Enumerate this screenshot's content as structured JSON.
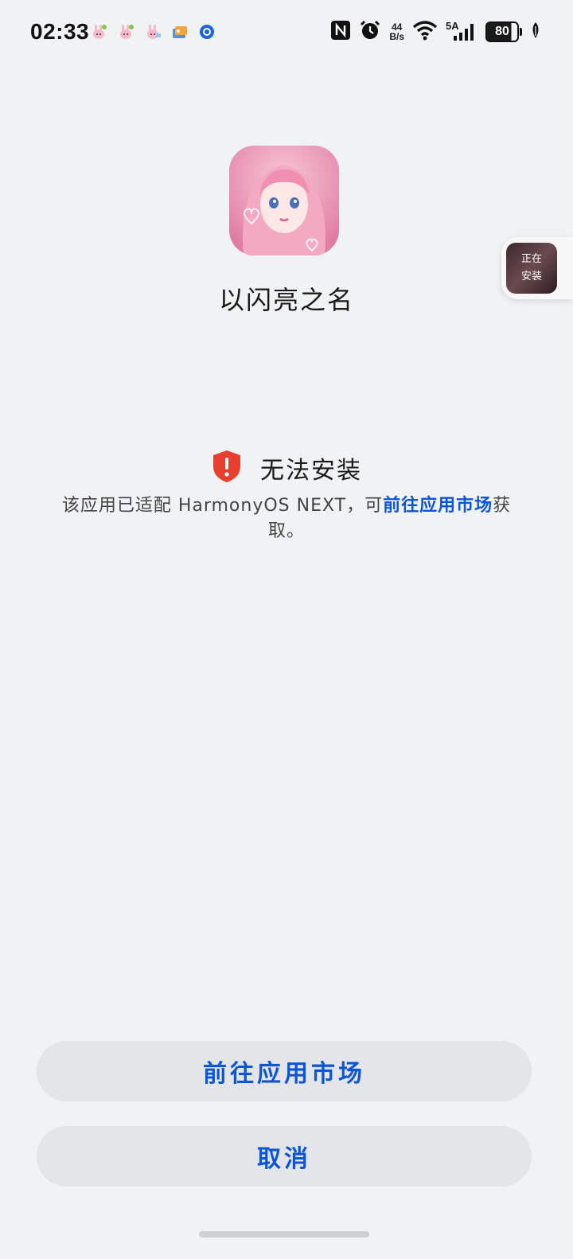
{
  "status_bar": {
    "time": "02:33",
    "net_speed_value": "44",
    "net_speed_unit": "B/s",
    "signal_label": "5A",
    "battery": "80"
  },
  "app": {
    "name": "以闪亮之名"
  },
  "floating_badge": {
    "line1": "正在",
    "line2": "安装"
  },
  "dialog": {
    "title": "无法安装",
    "message_prefix": "该应用已适配 HarmonyOS NEXT，可",
    "message_link": "前往应用市场",
    "message_suffix": "获取。"
  },
  "buttons": {
    "market": "前往应用市场",
    "cancel": "取消"
  },
  "colors": {
    "accent": "#0b55d6",
    "error": "#e8402e",
    "background": "#f1f2f4",
    "button_bg": "#e4e5e8"
  }
}
